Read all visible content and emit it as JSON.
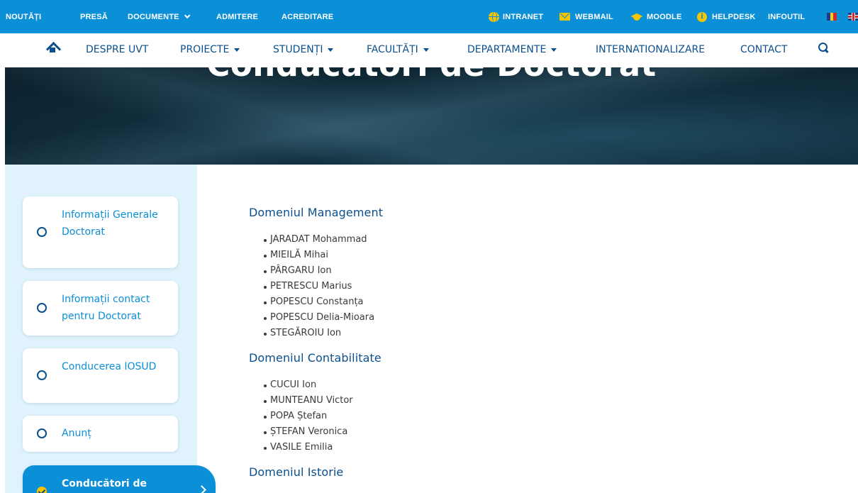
{
  "topbar": {
    "links": [
      "NOUTĂȚI",
      "PRESĂ",
      "DOCUMENTE",
      "ADMITERE",
      "ACREDITARE"
    ],
    "quick_links": [
      "INTRANET",
      "WEBMAIL",
      "MOODLE",
      "HELPDESK",
      "INFOUTIL"
    ],
    "icons": [
      "globe-icon",
      "mail-icon",
      "graduation-cap-icon",
      "info-icon",
      "flag-ro-icon",
      "flag-uk-icon"
    ]
  },
  "nav": {
    "items": [
      "DESPRE UVT",
      "PROIECTE",
      "STUDENȚI",
      "FACULTĂȚI",
      "DEPARTAMENTE",
      "INTERNATIONALIZARE",
      "CONTACT"
    ]
  },
  "hero": {
    "title": "Conducători de Doctorat"
  },
  "sidebar": {
    "items": [
      {
        "label": "Informații Generale Doctorat"
      },
      {
        "label": "Informații contact pentru Doctorat"
      },
      {
        "label": "Conducerea IOSUD"
      },
      {
        "label": "Anunț"
      },
      {
        "label": "Conducători de"
      }
    ]
  },
  "content": {
    "domains": [
      {
        "title": "Domeniul Management",
        "people": [
          "JARADAT Mohammad",
          "MIEILĂ Mihai",
          "PÂRGARU Ion",
          "PETRESCU Marius",
          "POPESCU Constanța",
          "POPESCU Delia-Mioara",
          "STEGĂROIU Ion"
        ]
      },
      {
        "title": "Domeniul Contabilitate",
        "people": [
          "CUCUI Ion",
          "MUNTEANU Victor",
          "POPA Ștefan",
          "ȘTEFAN Veronica",
          "VASILE Emilia"
        ]
      },
      {
        "title": "Domeniul Istorie",
        "people": []
      }
    ]
  },
  "colors": {
    "topbar_bg": "#0b8fd6",
    "nav_text": "#0b4f8c",
    "accent_yellow": "#f7c600",
    "sidebar_bg": "#e0f3fd"
  }
}
